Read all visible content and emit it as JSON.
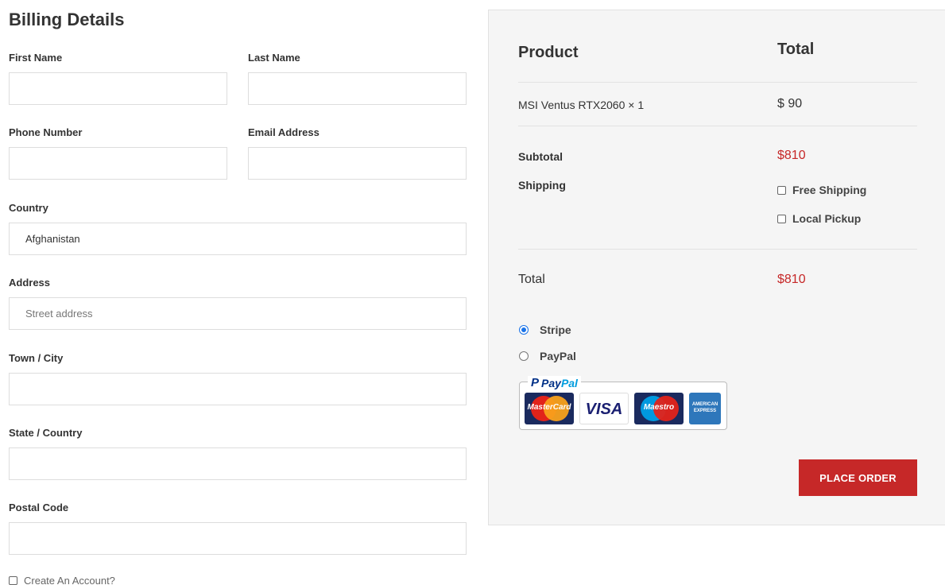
{
  "billing": {
    "title": "Billing Details",
    "first_name": {
      "label": "First Name",
      "value": "",
      "placeholder": ""
    },
    "last_name": {
      "label": "Last Name",
      "value": "",
      "placeholder": ""
    },
    "phone": {
      "label": "Phone Number",
      "value": "",
      "placeholder": ""
    },
    "email": {
      "label": "Email Address",
      "value": "",
      "placeholder": ""
    },
    "country": {
      "label": "Country",
      "value": "Afghanistan"
    },
    "address": {
      "label": "Address",
      "value": "",
      "placeholder": "Street address"
    },
    "town": {
      "label": "Town / City",
      "value": "",
      "placeholder": ""
    },
    "state": {
      "label": "State / Country",
      "value": "",
      "placeholder": ""
    },
    "postal": {
      "label": "Postal Code",
      "value": "",
      "placeholder": ""
    },
    "create_account": {
      "label": "Create An Account?",
      "checked": false
    }
  },
  "order": {
    "col_product": "Product",
    "col_total": "Total",
    "items": [
      {
        "name": "MSI Ventus RTX2060 × 1",
        "price": "$ 90"
      }
    ],
    "subtotal_label": "Subtotal",
    "subtotal_value": "$810",
    "shipping_label": "Shipping",
    "shipping_options": [
      {
        "label": "Free Shipping",
        "checked": false
      },
      {
        "label": "Local Pickup",
        "checked": false
      }
    ],
    "total_label": "Total",
    "total_value": "$810",
    "payment_methods": [
      {
        "label": "Stripe",
        "selected": true
      },
      {
        "label": "PayPal",
        "selected": false
      }
    ],
    "paypal_badge": {
      "logo_p": "P",
      "logo_pay": "Pay",
      "logo_pal": "Pal",
      "cards": {
        "mastercard": "MasterCard",
        "visa": "VISA",
        "maestro": "Maestro",
        "amex": "AMERICAN EXPRESS"
      }
    },
    "place_order_label": "PLACE ORDER"
  },
  "colors": {
    "accent_red": "#c62828",
    "radio_blue": "#1a73e8",
    "panel_bg": "#f5f5f5"
  }
}
